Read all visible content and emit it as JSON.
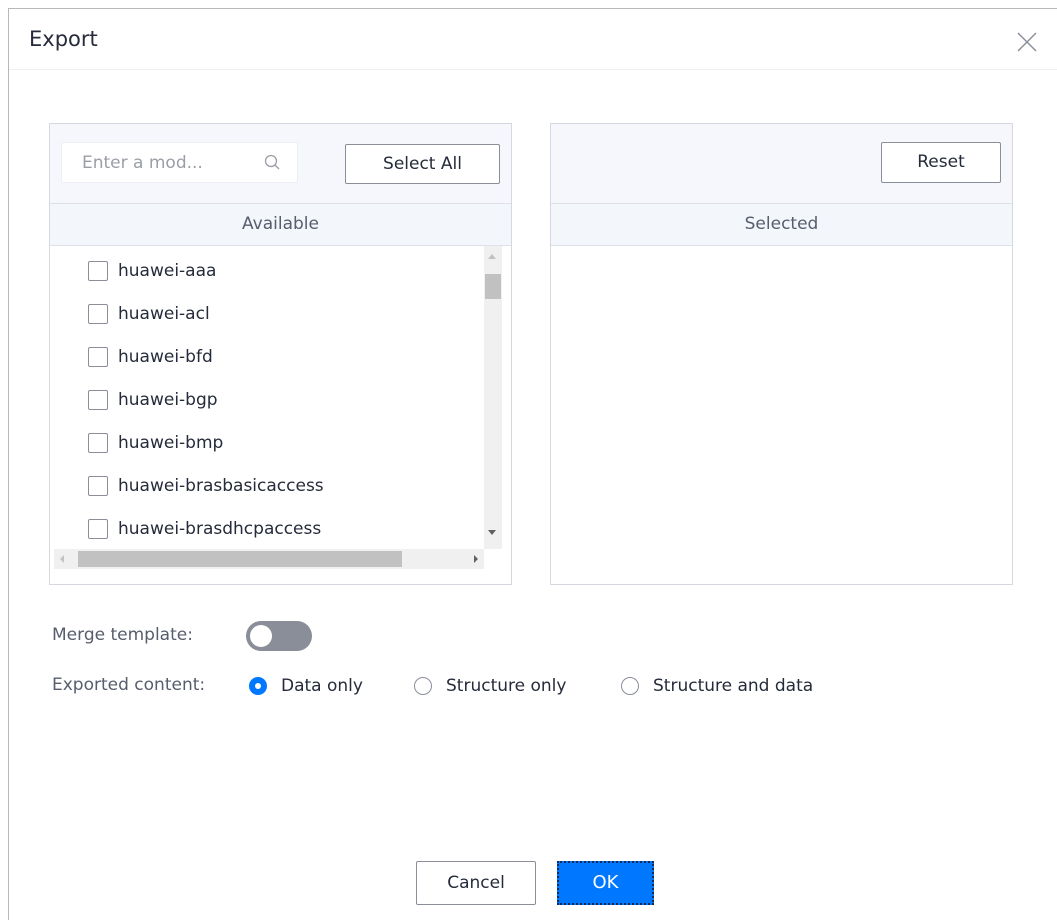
{
  "dialog": {
    "title": "Export",
    "close_icon": "close-icon"
  },
  "available_panel": {
    "search_placeholder": "Enter a mod...",
    "search_value": "",
    "search_icon": "search-icon",
    "select_all_label": "Select All",
    "header": "Available",
    "items": [
      {
        "label": "huawei-aaa",
        "checked": false
      },
      {
        "label": "huawei-acl",
        "checked": false
      },
      {
        "label": "huawei-bfd",
        "checked": false
      },
      {
        "label": "huawei-bgp",
        "checked": false
      },
      {
        "label": "huawei-bmp",
        "checked": false
      },
      {
        "label": "huawei-brasbasicaccess",
        "checked": false
      },
      {
        "label": "huawei-brasdhcpaccess",
        "checked": false
      }
    ]
  },
  "selected_panel": {
    "reset_label": "Reset",
    "header": "Selected",
    "items": []
  },
  "options": {
    "merge_template_label": "Merge template:",
    "merge_template_enabled": false,
    "exported_content_label": "Exported content:",
    "exported_content_options": [
      {
        "label": "Data only",
        "selected": true
      },
      {
        "label": "Structure only",
        "selected": false
      },
      {
        "label": "Structure and data",
        "selected": false
      }
    ]
  },
  "footer": {
    "cancel_label": "Cancel",
    "ok_label": "OK"
  },
  "colors": {
    "primary": "#0077ff",
    "toggle_off": "#8a8e99",
    "panel_header_bg": "#f3f6fb"
  }
}
